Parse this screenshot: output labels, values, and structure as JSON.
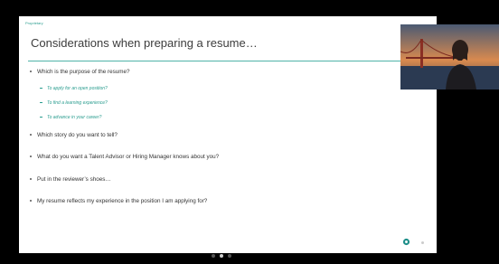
{
  "slide": {
    "proprietary_label": "Proprietary",
    "title": "Considerations when preparing a resume…",
    "bullets": [
      {
        "text": "Which is the purpose of the resume?",
        "subs": [
          "To apply for an open position?",
          "To find a learning experience?",
          "To advance in your career?"
        ]
      },
      {
        "text": "Which story do you want to tell?"
      },
      {
        "text": "What do you want a Talent Advisor or Hiring Manager knows about you?"
      },
      {
        "text": "Put in the reviewer’s shoes…"
      },
      {
        "text": "My resume reflects my experience in the position I am applying for?"
      }
    ]
  },
  "colors": {
    "accent": "#2a9d8f",
    "rule": "#4fb3a9",
    "logo": "#1f8f8a"
  },
  "icons": {
    "logo": "brand-logo-icon"
  },
  "pager": {
    "count": 3,
    "active_index": 1
  }
}
